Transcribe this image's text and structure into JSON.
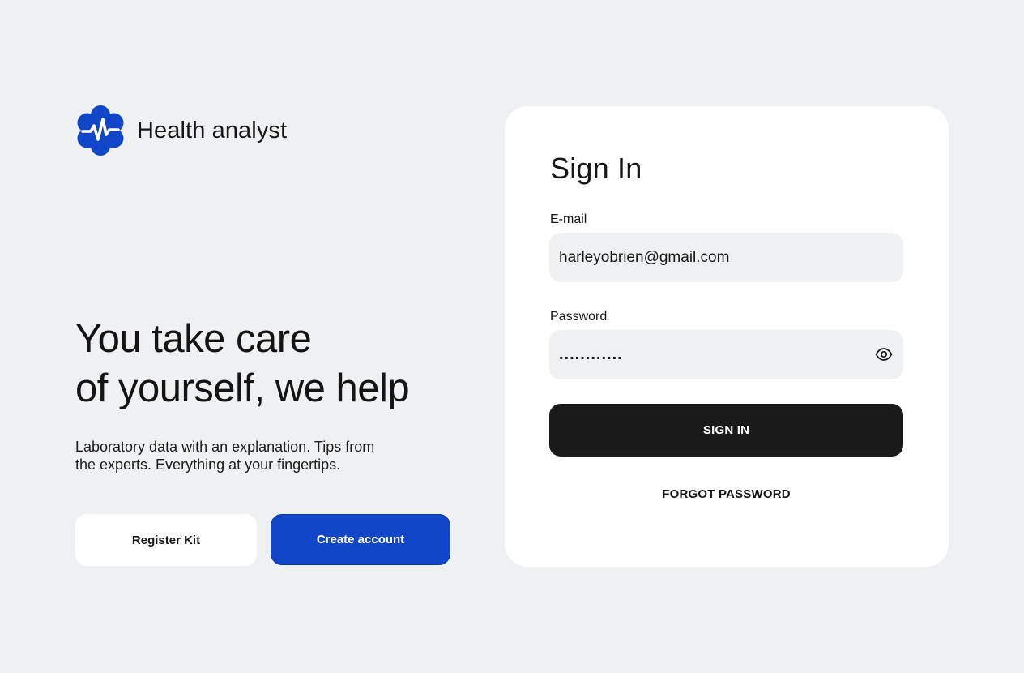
{
  "colors": {
    "background": "#eff0f2",
    "brand_blue": "#1246c8",
    "card": "#ffffff",
    "field_bg": "#eff0f2",
    "dark_button": "#1a1a1a",
    "text": "#161616"
  },
  "brand": {
    "logo_icon": "medical-star-pulse-icon",
    "name": "Health analyst"
  },
  "hero": {
    "title_line1": "You take care",
    "title_line2": "of yourself, we help",
    "subtitle_line1": "Laboratory data with an explanation. Tips from",
    "subtitle_line2": "the experts. Everything at your fingertips.",
    "register_kit_label": "Register Kit",
    "create_account_label": "Create account"
  },
  "signin": {
    "title": "Sign In",
    "email_label": "E-mail",
    "email_value": "harleyobrien@gmail.com",
    "password_label": "Password",
    "password_value": "............",
    "password_toggle_icon": "eye-icon",
    "submit_label": "SIGN IN",
    "forgot_label": "FORGOT PASSWORD"
  }
}
